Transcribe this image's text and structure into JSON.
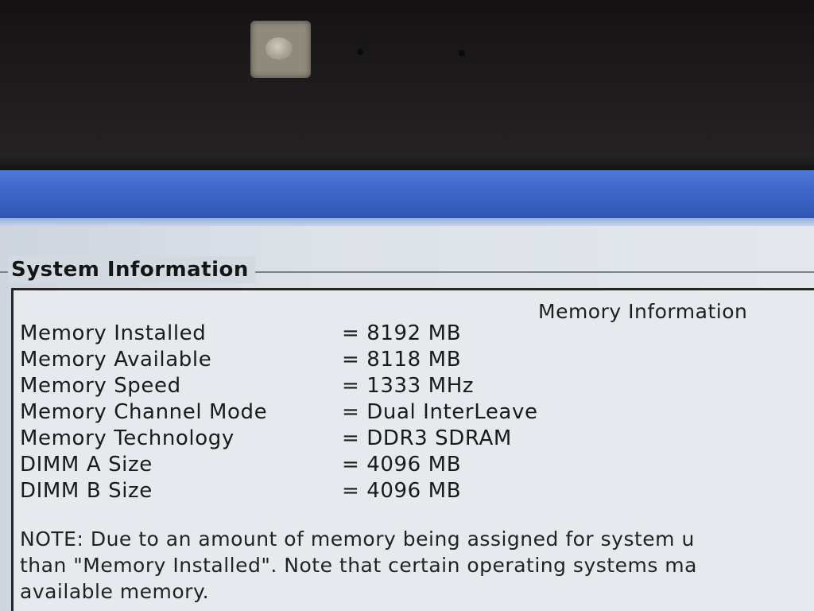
{
  "system_info": {
    "group_title": "System Information",
    "section_heading": "Memory Information",
    "rows": [
      {
        "label": "Memory Installed",
        "value": "= 8192 MB"
      },
      {
        "label": "Memory Available",
        "value": "= 8118 MB"
      },
      {
        "label": "Memory Speed",
        "value": "= 1333 MHz"
      },
      {
        "label": "Memory Channel Mode",
        "value": "= Dual InterLeave"
      },
      {
        "label": "Memory Technology",
        "value": "= DDR3 SDRAM"
      },
      {
        "label": "DIMM A Size",
        "value": "= 4096 MB"
      },
      {
        "label": "DIMM B Size",
        "value": "= 4096 MB"
      }
    ],
    "note_lines": [
      "NOTE: Due to an amount of memory being assigned for system u",
      "than \"Memory Installed\". Note that certain operating systems ma",
      "available memory."
    ]
  },
  "colors": {
    "title_bar": "#3d66c8",
    "panel_background": "#dce1e8",
    "text": "#1a1a1a"
  }
}
